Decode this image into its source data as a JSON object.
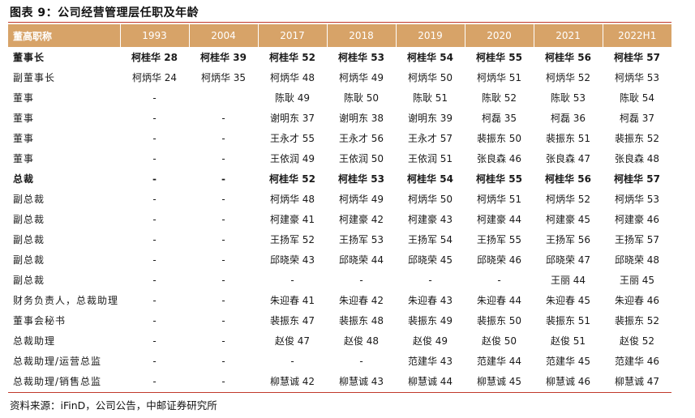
{
  "title": "图表 9：公司经营管理层任职及年龄",
  "headers": [
    "董高职称",
    "1993",
    "2004",
    "2017",
    "2018",
    "2019",
    "2020",
    "2021",
    "2022H1"
  ],
  "rows": [
    {
      "bold": true,
      "cells": [
        "董事长",
        "柯桂华 28",
        "柯桂华 39",
        "柯桂华 52",
        "柯桂华 53",
        "柯桂华 54",
        "柯桂华 55",
        "柯桂华 56",
        "柯桂华 57"
      ]
    },
    {
      "bold": false,
      "cells": [
        "副董事长",
        "柯炳华 24",
        "柯炳华 35",
        "柯炳华 48",
        "柯炳华 49",
        "柯炳华 50",
        "柯炳华 51",
        "柯炳华 52",
        "柯炳华 53"
      ]
    },
    {
      "bold": false,
      "cells": [
        "董事",
        "-",
        "",
        "陈耿 49",
        "陈耿 50",
        "陈耿 51",
        "陈耿 52",
        "陈耿 53",
        "陈耿 54"
      ]
    },
    {
      "bold": false,
      "cells": [
        "董事",
        "-",
        "-",
        "谢明东 37",
        "谢明东 38",
        "谢明东 39",
        "柯磊 35",
        "柯磊 36",
        "柯磊 37"
      ]
    },
    {
      "bold": false,
      "cells": [
        "董事",
        "-",
        "-",
        "王永才 55",
        "王永才 56",
        "王永才 57",
        "裴振东 50",
        "裴振东 51",
        "裴振东 52"
      ]
    },
    {
      "bold": false,
      "cells": [
        "董事",
        "-",
        "-",
        "王依润 49",
        "王依润 50",
        "王依润 51",
        "张良森 46",
        "张良森 47",
        "张良森 48"
      ]
    },
    {
      "bold": true,
      "cells": [
        "总裁",
        "-",
        "-",
        "柯桂华 52",
        "柯桂华 53",
        "柯桂华 54",
        "柯桂华 55",
        "柯桂华 56",
        "柯桂华 57"
      ]
    },
    {
      "bold": false,
      "cells": [
        "副总裁",
        "-",
        "-",
        "柯炳华 48",
        "柯炳华 49",
        "柯炳华 50",
        "柯炳华 51",
        "柯炳华 52",
        "柯炳华 53"
      ]
    },
    {
      "bold": false,
      "cells": [
        "副总裁",
        "-",
        "-",
        "柯建豪 41",
        "柯建豪 42",
        "柯建豪 43",
        "柯建豪 44",
        "柯建豪 45",
        "柯建豪 46"
      ]
    },
    {
      "bold": false,
      "cells": [
        "副总裁",
        "-",
        "-",
        "王扬军 52",
        "王扬军 53",
        "王扬军 54",
        "王扬军 55",
        "王扬军 56",
        "王扬军 57"
      ]
    },
    {
      "bold": false,
      "cells": [
        "副总裁",
        "-",
        "-",
        "邱晓荣 43",
        "邱晓荣 44",
        "邱晓荣 45",
        "邱晓荣 46",
        "邱晓荣 47",
        "邱晓荣 48"
      ]
    },
    {
      "bold": false,
      "cells": [
        "副总裁",
        "-",
        "-",
        "-",
        "-",
        "-",
        "-",
        "王丽 44",
        "王丽 45"
      ]
    },
    {
      "bold": false,
      "cells": [
        "财务负责人，总裁助理",
        "-",
        "-",
        "朱迎春 41",
        "朱迎春 42",
        "朱迎春 43",
        "朱迎春 44",
        "朱迎春 45",
        "朱迎春 46"
      ]
    },
    {
      "bold": false,
      "cells": [
        "董事会秘书",
        "-",
        "-",
        "裴振东 47",
        "裴振东 48",
        "裴振东 49",
        "裴振东 50",
        "裴振东 51",
        "裴振东 52"
      ]
    },
    {
      "bold": false,
      "cells": [
        "总裁助理",
        "-",
        "-",
        "赵俊 47",
        "赵俊 48",
        "赵俊 49",
        "赵俊 50",
        "赵俊 51",
        "赵俊 52"
      ]
    },
    {
      "bold": false,
      "cells": [
        "总裁助理/运营总监",
        "-",
        "-",
        "-",
        "-",
        "范建华 43",
        "范建华 44",
        "范建华 45",
        "范建华 46"
      ]
    },
    {
      "bold": false,
      "cells": [
        "总裁助理/销售总监",
        "-",
        "-",
        "柳慧诚 42",
        "柳慧诚 43",
        "柳慧诚 44",
        "柳慧诚 45",
        "柳慧诚 46",
        "柳慧诚 47"
      ]
    }
  ],
  "source": "资料来源：iFinD，公司公告，中邮证券研究所",
  "colors": {
    "header_bg": "#d7a368",
    "rule": "#c0392b"
  }
}
